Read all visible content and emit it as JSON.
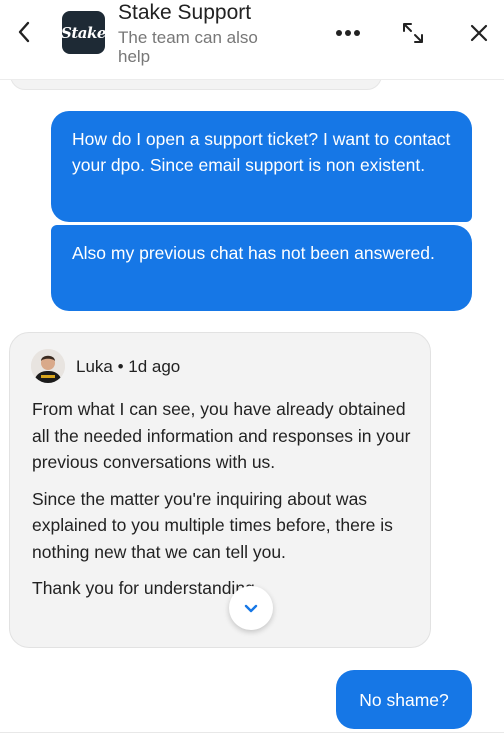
{
  "header": {
    "logo_text": "Stake",
    "title": "Stake Support",
    "subtitle": "The team can also help",
    "icons": {
      "back": "chevron-left-icon",
      "more": "more-horizontal-icon",
      "expand": "expand-icon",
      "close": "close-icon"
    }
  },
  "messages": {
    "user_1": "How do I open a support ticket? I want to contact your dpo. Since email support is non existent.",
    "user_2": "Also my previous chat has not been answered.",
    "agent": {
      "name_time": "Luka • 1d ago",
      "paragraph_1": "From what I can see, you have already obtained all the needed information and responses in your previous conversations with us.",
      "paragraph_2": "Since the matter you're inquiring about was explained to you multiple times before, there is nothing new that we can tell you.",
      "paragraph_3": "Thank you for understanding."
    },
    "user_3": "No shame?"
  },
  "colors": {
    "user_bubble": "#1677e6",
    "agent_bubble": "#f3f3f3",
    "accent": "#1677e6"
  }
}
